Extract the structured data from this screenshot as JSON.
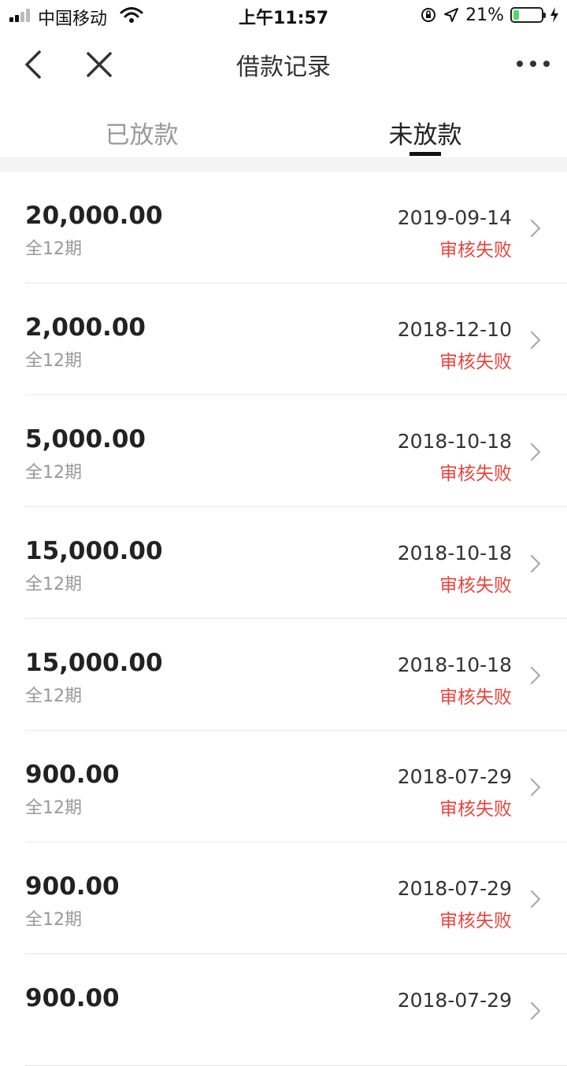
{
  "status_bar": {
    "carrier": "中国移动",
    "time": "上午11:57",
    "battery_percent": "21%",
    "battery_level": 0.21
  },
  "nav": {
    "title": "借款记录",
    "back_icon": "chevron-left-icon",
    "close_icon": "close-icon",
    "more_icon": "more-dots-icon"
  },
  "tabs": [
    {
      "label": "已放款",
      "active": false
    },
    {
      "label": "未放款",
      "active": true
    }
  ],
  "records": [
    {
      "amount": "20,000.00",
      "periods": "全12期",
      "date": "2019-09-14",
      "status": "审核失败"
    },
    {
      "amount": "2,000.00",
      "periods": "全12期",
      "date": "2018-12-10",
      "status": "审核失败"
    },
    {
      "amount": "5,000.00",
      "periods": "全12期",
      "date": "2018-10-18",
      "status": "审核失败"
    },
    {
      "amount": "15,000.00",
      "periods": "全12期",
      "date": "2018-10-18",
      "status": "审核失败"
    },
    {
      "amount": "15,000.00",
      "periods": "全12期",
      "date": "2018-10-18",
      "status": "审核失败"
    },
    {
      "amount": "900.00",
      "periods": "全12期",
      "date": "2018-07-29",
      "status": "审核失败"
    },
    {
      "amount": "900.00",
      "periods": "全12期",
      "date": "2018-07-29",
      "status": "审核失败"
    },
    {
      "amount": "900.00",
      "periods": "",
      "date": "2018-07-29",
      "status": ""
    }
  ],
  "colors": {
    "status_failed": "#e8453c",
    "battery": "#4cd964",
    "tab_active": "#222222",
    "tab_inactive": "#9a9a9a"
  }
}
